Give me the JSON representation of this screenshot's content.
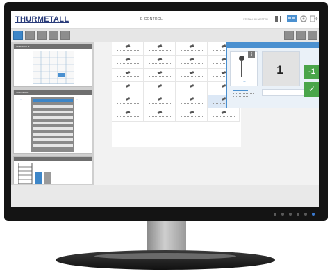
{
  "app": {
    "logo": "THURMETALL",
    "title": "E-CONTROL",
    "user": "STEFAN SCHAEFFER"
  },
  "panels": {
    "left_top_header": "UEBERSICHT",
    "left_mid_header": "SCHUBLADE"
  },
  "detail": {
    "count": "1",
    "minus_label": "-1",
    "ok_glyph": "✓",
    "info_glyph": "i"
  },
  "colors": {
    "accent": "#4a90d0",
    "ok_green": "#4aa54a",
    "logo": "#2a3c7a"
  },
  "icons": [
    "barcode-icon",
    "grid-icon",
    "settings-icon",
    "logout-icon",
    "info-icon",
    "checkmark-icon"
  ]
}
